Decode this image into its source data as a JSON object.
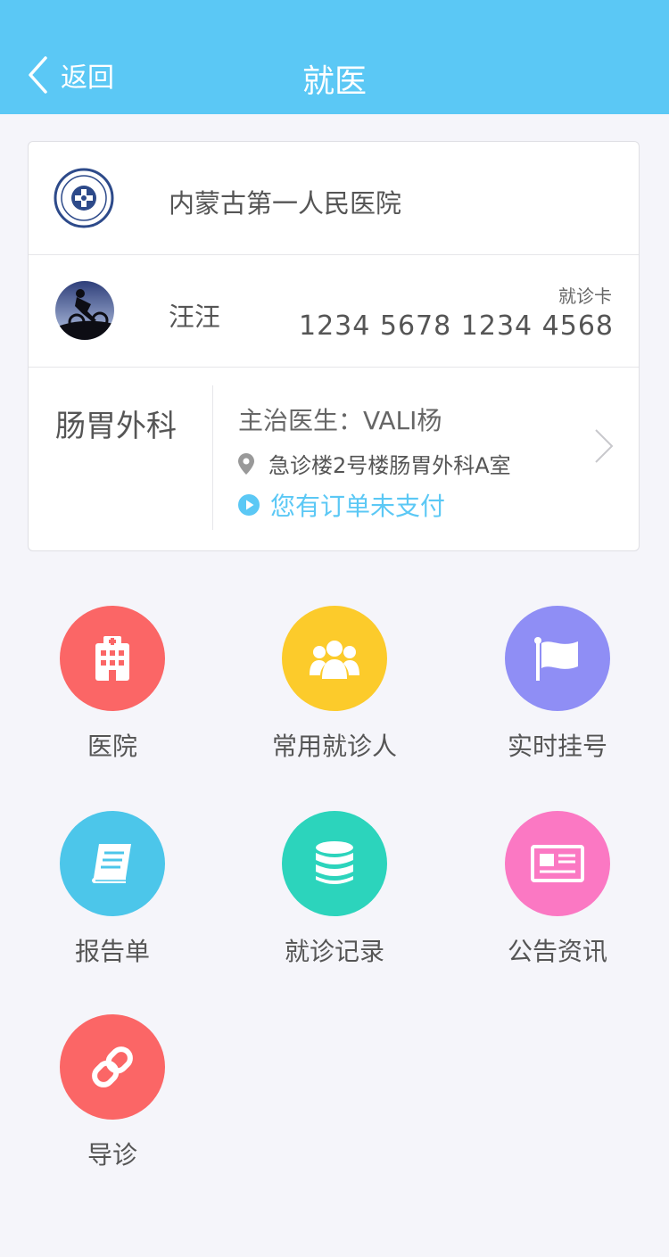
{
  "nav": {
    "back_label": "返回",
    "title": "就医"
  },
  "hospital": {
    "name": "内蒙古第一人民医院"
  },
  "patient": {
    "name": "汪汪",
    "card_label": "就诊卡",
    "card_number": "1234 5678 1234 4568"
  },
  "visit": {
    "department": "肠胃外科",
    "doctor": "主治医生：VALI杨",
    "location": "急诊楼2号楼肠胃外科A室",
    "unpaid_notice": "您有订单未支付"
  },
  "menu": [
    {
      "label": "医院",
      "icon": "hospital-building-icon",
      "color": "#fb6666"
    },
    {
      "label": "常用就诊人",
      "icon": "people-group-icon",
      "color": "#fccb2b"
    },
    {
      "label": "实时挂号",
      "icon": "flag-icon",
      "color": "#8f8ef5"
    },
    {
      "label": "报告单",
      "icon": "report-book-icon",
      "color": "#4cc6ea"
    },
    {
      "label": "就诊记录",
      "icon": "records-database-icon",
      "color": "#2cd4bc"
    },
    {
      "label": "公告资讯",
      "icon": "newspaper-icon",
      "color": "#fb78c3"
    },
    {
      "label": "导诊",
      "icon": "link-chain-icon",
      "color": "#fb6666"
    }
  ],
  "colors": {
    "accent": "#5bc8f5",
    "background": "#f5f5fa"
  }
}
